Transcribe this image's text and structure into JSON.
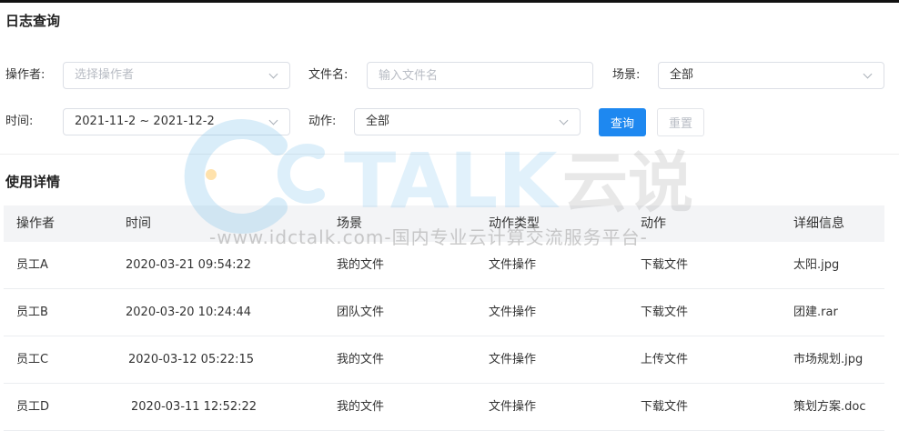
{
  "page_title": "日志查询",
  "filters": {
    "operator": {
      "label": "操作者:",
      "placeholder": "选择操作者"
    },
    "filename": {
      "label": "文件名:",
      "placeholder": "输入文件名"
    },
    "scene": {
      "label": "场景:",
      "value": "全部"
    },
    "time": {
      "label": "时间:",
      "value": "2021-11-2 ~ 2021-12-2"
    },
    "action": {
      "label": "动作:",
      "value": "全部"
    },
    "query_button": "查询",
    "reset_button": "重置"
  },
  "section_title": "使用详情",
  "table": {
    "headers": [
      "操作者",
      "时间",
      "场景",
      "动作类型",
      "动作",
      "详细信息"
    ],
    "rows": [
      [
        "员工A",
        "2020-03-21 09:54:22",
        "我的文件",
        "文件操作",
        "下载文件",
        "太阳.jpg"
      ],
      [
        "员工B",
        "2020-03-20 10:24:44",
        "团队文件",
        "文件操作",
        "下载文件",
        "团建.rar"
      ],
      [
        "员工C",
        "2020-03-12 05:22:15",
        "我的文件",
        "文件操作",
        "上传文件",
        "市场规划.jpg"
      ],
      [
        "员工D",
        "2020-03-11 12:52:22",
        "我的文件",
        "文件操作",
        "下载文件",
        "策划方案.doc"
      ]
    ]
  },
  "watermark": {
    "brand": "TALK",
    "brand_cn": "云说",
    "url_text": "-www.idctalk.com-国内专业云计算交流服务平台-"
  },
  "colors": {
    "primary": "#1e88f0",
    "header_bg": "#f3f4f6",
    "border": "#dcdfe6"
  }
}
